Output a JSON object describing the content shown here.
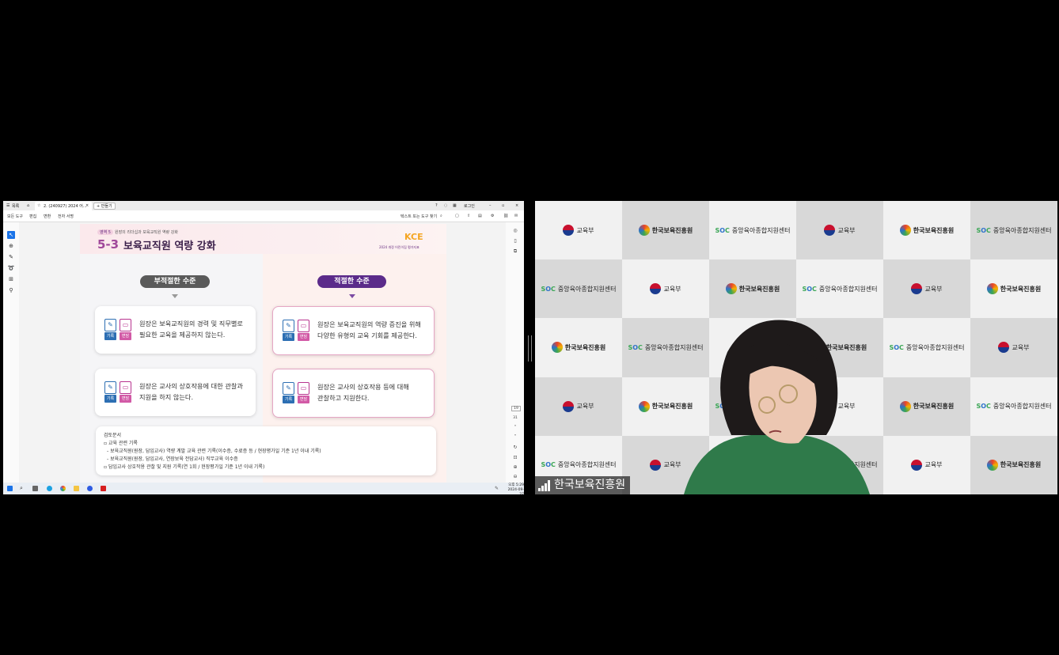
{
  "browser": {
    "tabs": [
      "목록",
      "2. (240927) 2024 어..."
    ],
    "new_tab": "+ 만들기",
    "login": "로그인",
    "menu": [
      "모든 도구",
      "편집",
      "변환",
      "전자 서명"
    ],
    "search": "텍스트 또는 도구 찾기"
  },
  "slide": {
    "breadcrumb_pill": "영역 5",
    "breadcrumb": "원장의 리더십과 보육교직원 역량 강화",
    "section_number": "5-3",
    "section_title": "보육교직원 역량 강화",
    "logo": "KCE",
    "logo_sub": "2024 개정 어린이집 평가지표",
    "col_bad": "부적절한 수준",
    "col_good": "적절한 수준",
    "badge_record": "기록",
    "badge_interview": "면담",
    "bad1": [
      "원장은 보육교직원의 경력 및 직무별로",
      "필요한 교육을 제공하지 않는다."
    ],
    "bad2": [
      "원장은 교사의 상호작용에 대한 관찰과",
      "지원을 하지 않는다."
    ],
    "good1": [
      "원장은 보육교직원의 역량 증진을 위해",
      "다양한 유형의 교육 기회를 제공한다."
    ],
    "good2": [
      "원장은 교사의 상호작용 등에 대해",
      "관찰하고 지원한다."
    ],
    "review_title": "검토문서",
    "review": [
      "교육 관련 기록",
      "- 보육교직원(원장, 담임교사) 역량 계발 교육 관련 기록(이수증, 수료증 등 / 현장평가일 기준 1년 이내 기록)",
      "- 보육교직원(원장, 담임교사, 연장보육 전담교사) 직무교육 이수증",
      "담임교사 상호작용 관찰 및 지원 기록(연 1회 / 현장평가일 기준 1년 이내 기록)"
    ]
  },
  "sidebar_page": {
    "current": "19",
    "total": "31"
  },
  "taskbar": {
    "time": "오후 5:29",
    "date": "2024-09-27"
  },
  "video": {
    "participant_name": "한국보육진흥원",
    "logos": {
      "moe": "교육부",
      "kcp": "한국보육진흥원",
      "center": "중앙육아종합지원센터"
    },
    "wall": [
      [
        "moe",
        "kcp",
        "center",
        "moe",
        "kcp",
        "center"
      ],
      [
        "center",
        "moe",
        "kcp",
        "center",
        "moe",
        "kcp"
      ],
      [
        "kcp",
        "center",
        "moe",
        "kcp",
        "center",
        "moe"
      ],
      [
        "moe",
        "kcp",
        "center",
        "moe",
        "kcp",
        "center"
      ],
      [
        "center",
        "moe",
        "kcp",
        "center",
        "moe",
        "kcp"
      ]
    ]
  }
}
